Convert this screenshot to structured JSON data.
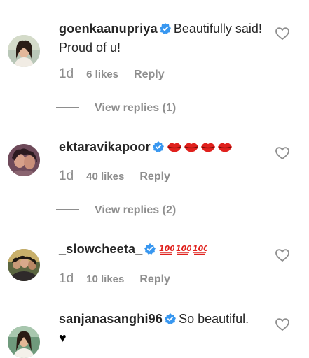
{
  "comments": [
    {
      "username": "goenkaanupriya",
      "text": "Beautifully said! Proud of u!",
      "emojis": "",
      "time": "1d",
      "likes": "6 likes",
      "reply_label": "Reply",
      "view_replies": "View replies (1)"
    },
    {
      "username": "ektaravikapoor",
      "text": "",
      "emojis": "💋💋💋💋",
      "time": "1d",
      "likes": "40 likes",
      "reply_label": "Reply",
      "view_replies": "View replies (2)"
    },
    {
      "username": "_slowcheeta_",
      "text": "",
      "emojis": "💯💯💯",
      "time": "1d",
      "likes": "10 likes",
      "reply_label": "Reply",
      "view_replies": ""
    },
    {
      "username": "sanjanasanghi96",
      "text": "So beautiful.",
      "text_line2": "♥",
      "emojis": "",
      "time": "",
      "likes": "",
      "reply_label": "",
      "view_replies": ""
    }
  ],
  "icons": {
    "verified": "verified-badge-icon",
    "like": "heart-outline-icon",
    "lips": "kiss-mark-emoji",
    "hundred": "hundred-points-emoji"
  },
  "colors": {
    "text": "#262626",
    "secondary": "#8e8e8e",
    "verified": "#3897f0",
    "emoji_red": "#e0211d"
  }
}
